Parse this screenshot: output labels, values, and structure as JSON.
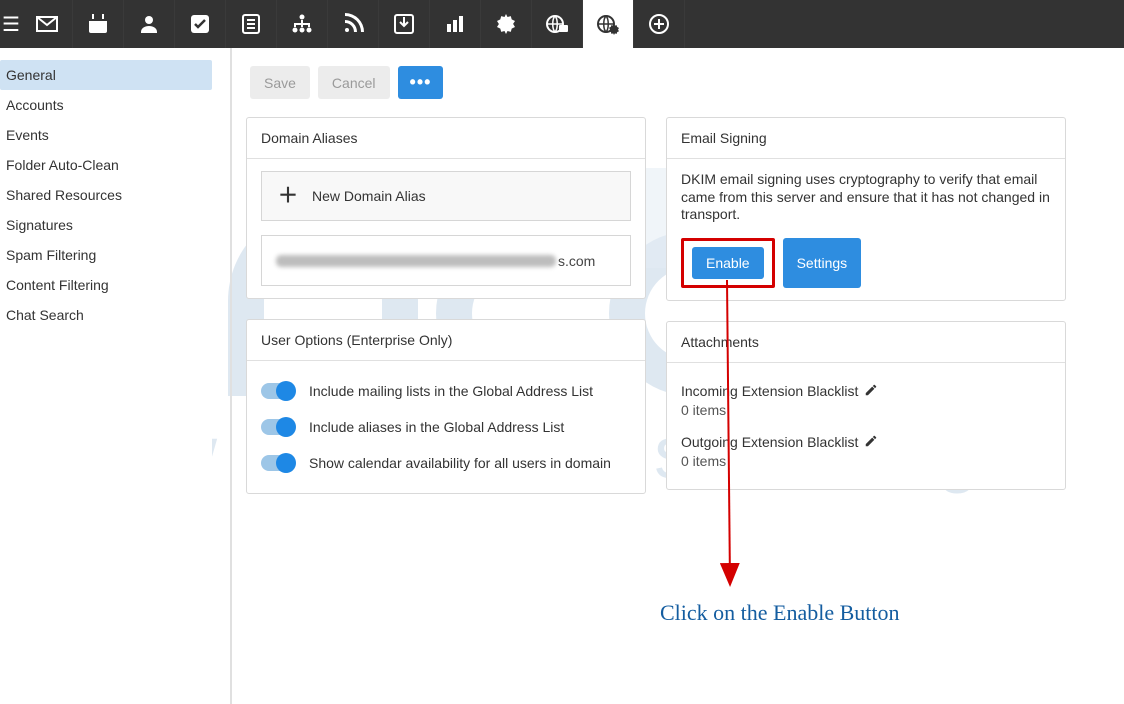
{
  "nav": {
    "active_index": 11
  },
  "sidebar": {
    "items": [
      {
        "label": "General",
        "selected": true
      },
      {
        "label": "Accounts"
      },
      {
        "label": "Events"
      },
      {
        "label": "Folder Auto-Clean"
      },
      {
        "label": "Shared Resources"
      },
      {
        "label": "Signatures"
      },
      {
        "label": "Spam Filtering"
      },
      {
        "label": "Content Filtering"
      },
      {
        "label": "Chat Search"
      }
    ]
  },
  "toolbar": {
    "save_label": "Save",
    "cancel_label": "Cancel",
    "more_label": "•••"
  },
  "domain_aliases": {
    "header": "Domain Aliases",
    "new_label": "New Domain Alias",
    "items": [
      {
        "text_suffix": "s.com"
      }
    ]
  },
  "user_options": {
    "header": "User Options (Enterprise Only)",
    "toggles": [
      {
        "label": "Include mailing lists in the Global Address List",
        "on": true
      },
      {
        "label": "Include aliases in the Global Address List",
        "on": true
      },
      {
        "label": "Show calendar availability for all users in domain",
        "on": true
      }
    ]
  },
  "email_signing": {
    "header": "Email Signing",
    "description": "DKIM email signing uses cryptography to verify that email came from this server and ensure that it has not changed in transport.",
    "enable_label": "Enable",
    "settings_label": "Settings"
  },
  "attachments": {
    "header": "Attachments",
    "incoming_label": "Incoming Extension Blacklist",
    "incoming_count": "0 items",
    "outgoing_label": "Outgoing Extension Blacklist",
    "outgoing_count": "0 items"
  },
  "annotation": {
    "text": "Click on the Enable Button"
  },
  "watermark_text": "web hosting"
}
